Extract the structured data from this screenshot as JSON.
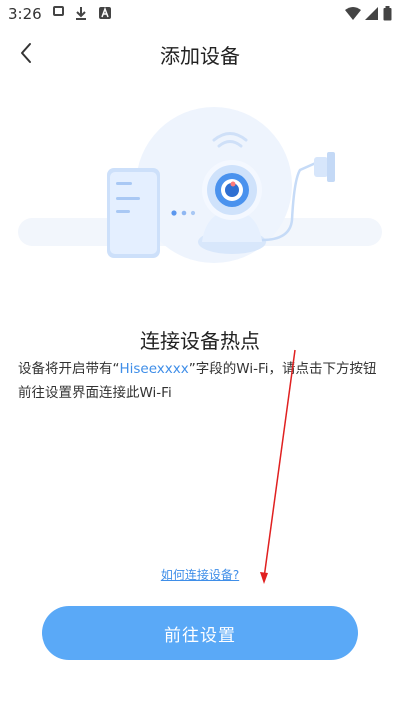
{
  "status_bar": {
    "time": "3:26",
    "icons": [
      "image-icon",
      "download-icon",
      "a-icon",
      "wifi-icon",
      "signal-icon",
      "battery-icon"
    ]
  },
  "nav": {
    "title": "添加设备"
  },
  "content": {
    "heading": "连接设备热点",
    "description_prefix": "设备将开启带有“",
    "description_highlight": "Hiseexxxx",
    "description_suffix": "”字段的Wi-Fi，请点击下方按钮前往设置界面连接此Wi-Fi"
  },
  "help_link": "如何连接设备?",
  "primary_button": "前往设置",
  "colors": {
    "accent": "#3f8ee8",
    "button": "#5aa9f7",
    "annotation_red": "#e02020"
  }
}
